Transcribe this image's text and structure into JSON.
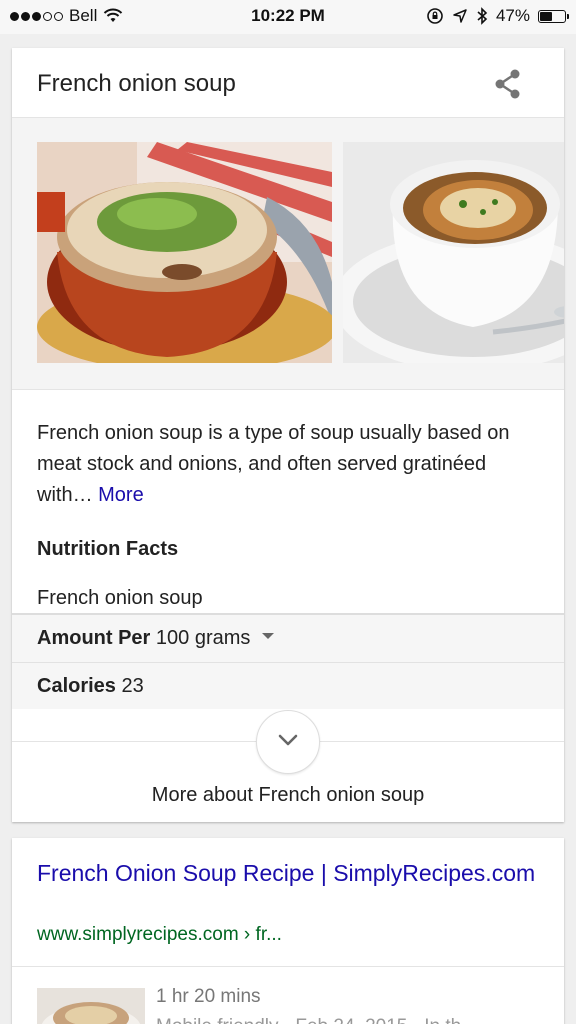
{
  "status_bar": {
    "carrier": "Bell",
    "time": "10:22 PM",
    "battery": "47%",
    "battery_level": 0.47,
    "signal_bars": 3,
    "signal_total": 5
  },
  "knowledge_card": {
    "title": "French onion soup",
    "images": [
      {
        "alt": "French onion soup in red crock with herbs"
      },
      {
        "alt": "French onion soup in white bowl with cheese crouton"
      }
    ],
    "description": "French onion soup is a type of soup usually based on meat stock and onions, and often served gratinéed with…",
    "more_link": "More",
    "nutrition": {
      "heading": "Nutrition Facts",
      "food": "French onion soup",
      "amount_label": "Amount Per",
      "amount_value": "100 grams",
      "calories_label": "Calories",
      "calories_value": "23"
    },
    "more_about": "More about French onion soup"
  },
  "result": {
    "title": "French Onion Soup Recipe | SimplyRecipes.com",
    "url": "www.simplyrecipes.com › fr...",
    "time": "1 hr 20 mins",
    "meta": "Mobile friendly · Feb 24, 2015 · In th"
  },
  "colors": {
    "link": "#1a0dab",
    "url_green": "#006621",
    "background": "#efefef"
  }
}
